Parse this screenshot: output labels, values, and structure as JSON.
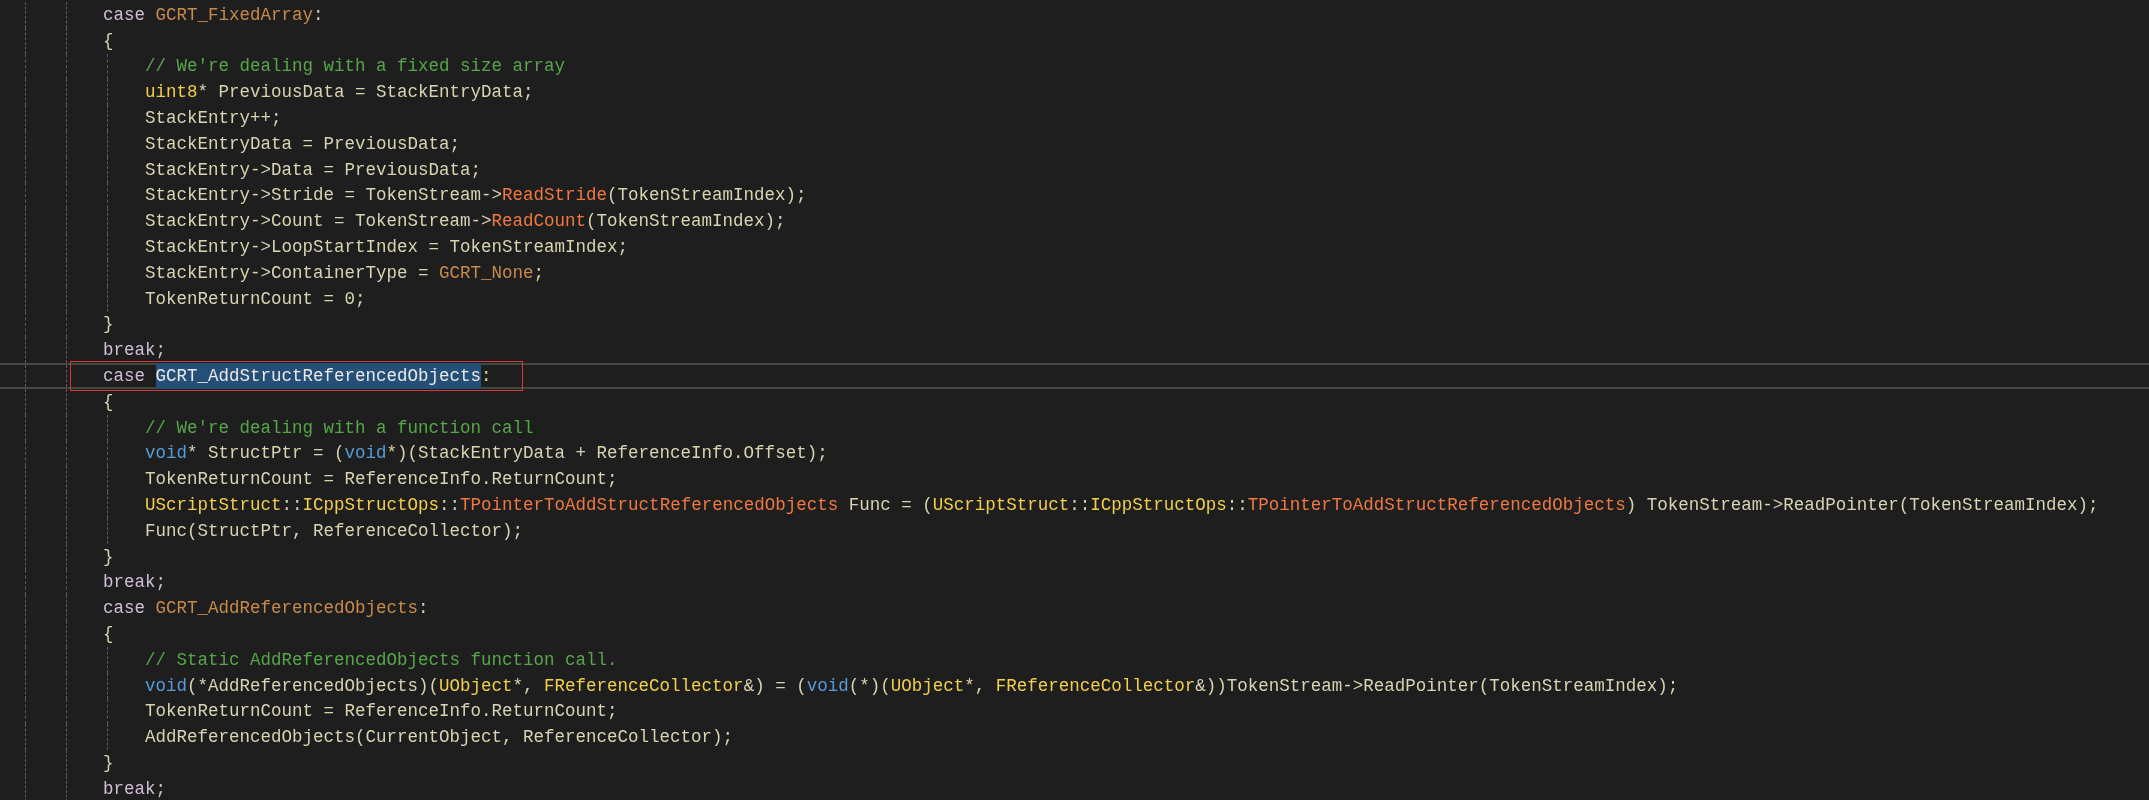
{
  "editor": {
    "lines": [
      {
        "tokens": [
          {
            "text": "case ",
            "kind": "keyword"
          },
          {
            "text": "GCRT_FixedArray",
            "kind": "enum"
          },
          {
            "text": ":",
            "kind": "plain"
          }
        ]
      },
      {
        "tokens": [
          {
            "text": "{",
            "kind": "plain"
          }
        ],
        "children": [
          {
            "tokens": [
              {
                "text": "// We're dealing with a fixed size array",
                "kind": "comment"
              }
            ]
          },
          {
            "tokens": [
              {
                "text": "uint8",
                "kind": "type"
              },
              {
                "text": "* PreviousData = StackEntryData;",
                "kind": "plain"
              }
            ]
          },
          {
            "tokens": [
              {
                "text": "StackEntry++;",
                "kind": "plain"
              }
            ]
          },
          {
            "tokens": [
              {
                "text": "StackEntryData = PreviousData;",
                "kind": "plain"
              }
            ]
          },
          {
            "tokens": [
              {
                "text": "StackEntry->Data = PreviousData;",
                "kind": "plain"
              }
            ]
          },
          {
            "tokens": [
              {
                "text": "StackEntry->Stride = TokenStream->",
                "kind": "plain"
              },
              {
                "text": "ReadStride",
                "kind": "function"
              },
              {
                "text": "(TokenStreamIndex);",
                "kind": "plain"
              }
            ]
          },
          {
            "tokens": [
              {
                "text": "StackEntry->Count = TokenStream->",
                "kind": "plain"
              },
              {
                "text": "ReadCount",
                "kind": "function"
              },
              {
                "text": "(TokenStreamIndex);",
                "kind": "plain"
              }
            ]
          },
          {
            "tokens": [
              {
                "text": "StackEntry->LoopStartIndex = TokenStreamIndex;",
                "kind": "plain"
              }
            ]
          },
          {
            "tokens": [
              {
                "text": "StackEntry->ContainerType = ",
                "kind": "plain"
              },
              {
                "text": "GCRT_None",
                "kind": "enum"
              },
              {
                "text": ";",
                "kind": "plain"
              }
            ]
          },
          {
            "tokens": [
              {
                "text": "TokenReturnCount = 0;",
                "kind": "plain"
              }
            ]
          }
        ]
      },
      {
        "tokens": [
          {
            "text": "}",
            "kind": "plain"
          }
        ]
      },
      {
        "tokens": [
          {
            "text": "break;",
            "kind": "keyword"
          }
        ]
      },
      {
        "current": true,
        "tokens": [
          {
            "text": "case ",
            "kind": "keyword",
            "selected": false
          },
          {
            "text": "GCRT_AddStructReferencedObjects",
            "selected": true
          },
          {
            "text": ":",
            "kind": "plain",
            "selected": false
          }
        ]
      },
      {
        "tokens": [
          {
            "text": "{",
            "kind": "plain"
          }
        ],
        "children": [
          {
            "tokens": [
              {
                "text": "// We're dealing with a function call",
                "kind": "comment"
              }
            ]
          },
          {
            "tokens": [
              {
                "text": "void",
                "kind": "builtin"
              },
              {
                "text": "* StructPtr = (",
                "kind": "plain"
              },
              {
                "text": "void",
                "kind": "builtin"
              },
              {
                "text": "*)(StackEntryData + ReferenceInfo.Offset);",
                "kind": "plain"
              }
            ]
          },
          {
            "tokens": [
              {
                "text": "TokenReturnCount = ReferenceInfo.ReturnCount;",
                "kind": "plain"
              }
            ]
          },
          {
            "tokens": [
              {
                "text": "UScriptStruct",
                "kind": "type"
              },
              {
                "text": "::",
                "kind": "plain"
              },
              {
                "text": "ICppStructOps",
                "kind": "type"
              },
              {
                "text": "::",
                "kind": "plain"
              },
              {
                "text": "TPointerToAddStructReferencedObjects",
                "kind": "function"
              },
              {
                "text": " Func = (",
                "kind": "plain"
              },
              {
                "text": "UScriptStruct",
                "kind": "type"
              },
              {
                "text": "::",
                "kind": "plain"
              },
              {
                "text": "ICppStructOps",
                "kind": "type"
              },
              {
                "text": "::",
                "kind": "plain"
              },
              {
                "text": "TPointerToAddStructReferencedObjects",
                "kind": "function"
              },
              {
                "text": ") TokenStream->ReadPointer(TokenStreamIndex);",
                "kind": "plain"
              }
            ]
          },
          {
            "tokens": [
              {
                "text": "Func(StructPtr, ReferenceCollector);",
                "kind": "plain"
              }
            ]
          }
        ]
      },
      {
        "tokens": [
          {
            "text": "}",
            "kind": "plain"
          }
        ]
      },
      {
        "tokens": [
          {
            "text": "break;",
            "kind": "keyword"
          }
        ]
      },
      {
        "tokens": [
          {
            "text": "case ",
            "kind": "keyword"
          },
          {
            "text": "GCRT_AddReferencedObjects",
            "kind": "enum"
          },
          {
            "text": ":",
            "kind": "plain"
          }
        ]
      },
      {
        "tokens": [
          {
            "text": "{",
            "kind": "plain"
          }
        ],
        "children": [
          {
            "tokens": [
              {
                "text": "// Static AddReferencedObjects function call.",
                "kind": "comment"
              }
            ]
          },
          {
            "tokens": [
              {
                "text": "void",
                "kind": "builtin"
              },
              {
                "text": "(*AddReferencedObjects)(",
                "kind": "plain"
              },
              {
                "text": "UObject",
                "kind": "type"
              },
              {
                "text": "*, ",
                "kind": "plain"
              },
              {
                "text": "FReferenceCollector",
                "kind": "type"
              },
              {
                "text": "&) = (",
                "kind": "plain"
              },
              {
                "text": "void",
                "kind": "builtin"
              },
              {
                "text": "(*)(",
                "kind": "plain"
              },
              {
                "text": "UObject",
                "kind": "type"
              },
              {
                "text": "*, ",
                "kind": "plain"
              },
              {
                "text": "FReferenceCollector",
                "kind": "type"
              },
              {
                "text": "&))TokenStream->ReadPointer(TokenStreamIndex);",
                "kind": "plain"
              }
            ]
          },
          {
            "tokens": [
              {
                "text": "TokenReturnCount = ReferenceInfo.ReturnCount;",
                "kind": "plain"
              }
            ]
          },
          {
            "tokens": [
              {
                "text": "AddReferencedObjects(CurrentObject, ReferenceCollector);",
                "kind": "plain"
              }
            ]
          }
        ]
      },
      {
        "tokens": [
          {
            "text": "}",
            "kind": "plain"
          }
        ]
      },
      {
        "tokens": [
          {
            "text": "break;",
            "kind": "keyword"
          }
        ]
      }
    ]
  }
}
